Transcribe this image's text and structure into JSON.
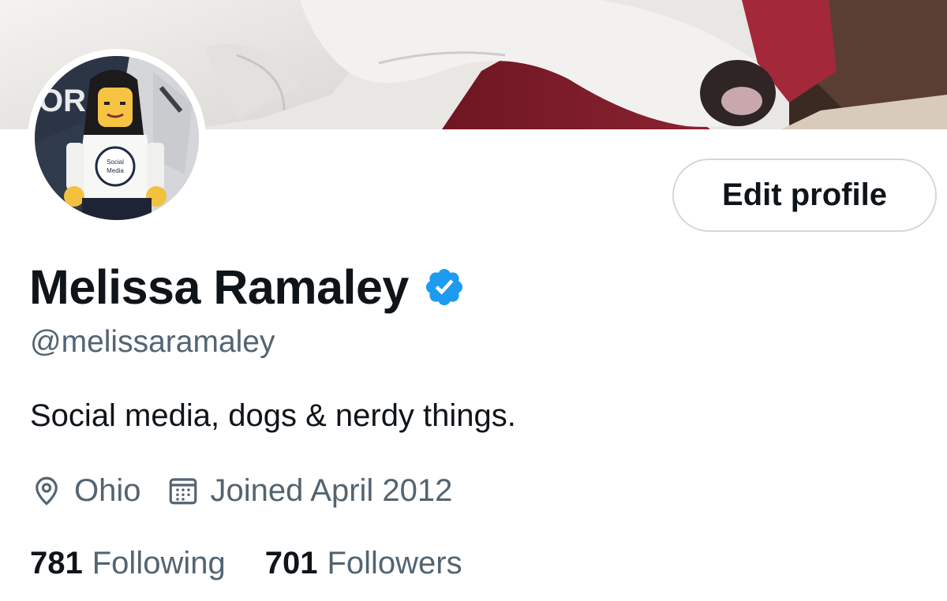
{
  "profile": {
    "display_name": "Melissa Ramaley",
    "handle": "@melissaramaley",
    "bio": "Social media, dogs & nerdy things.",
    "location": "Ohio",
    "joined": "Joined April 2012",
    "verified": true
  },
  "avatar": {
    "shirt_text_line1": "Social",
    "shirt_text_line2": "Media"
  },
  "actions": {
    "edit_profile_label": "Edit profile"
  },
  "stats": {
    "following_count": "781",
    "following_label": "Following",
    "followers_count": "701",
    "followers_label": "Followers"
  },
  "icons": {
    "verified": "verified-badge-icon",
    "location": "location-pin-icon",
    "calendar": "calendar-icon"
  },
  "colors": {
    "primary_text": "#0f1419",
    "secondary_text": "#536471",
    "verified_blue": "#1d9bf0",
    "button_border": "#cfd9de"
  }
}
